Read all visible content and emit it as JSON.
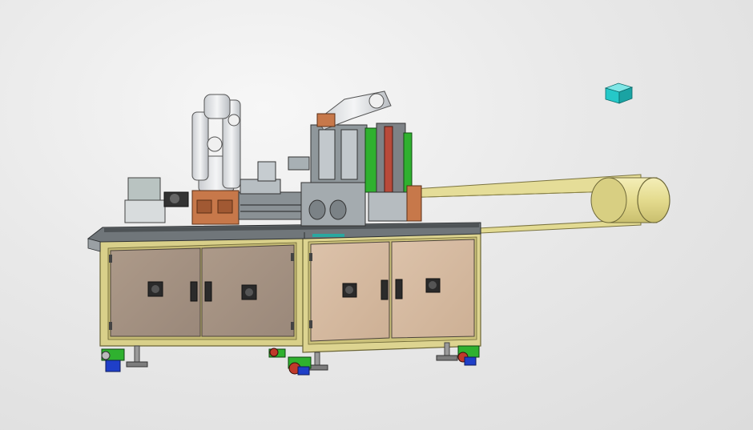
{
  "scene": {
    "background": "#e6e6e6",
    "colors": {
      "frame": "#d9d08a",
      "frame_dark": "#b8ae62",
      "panel_left": "#a89584",
      "panel_right": "#d7bba2",
      "worktop": "#5f6365",
      "robot": "#e8eaec",
      "belt": "#e2da95",
      "roller": "#ebe3a0",
      "accent_green": "#2fb12f",
      "accent_red": "#b84a3a",
      "accent_copper": "#c77a4c",
      "accent_blue": "#1f3fc8",
      "cube": "#25c8c8"
    }
  }
}
